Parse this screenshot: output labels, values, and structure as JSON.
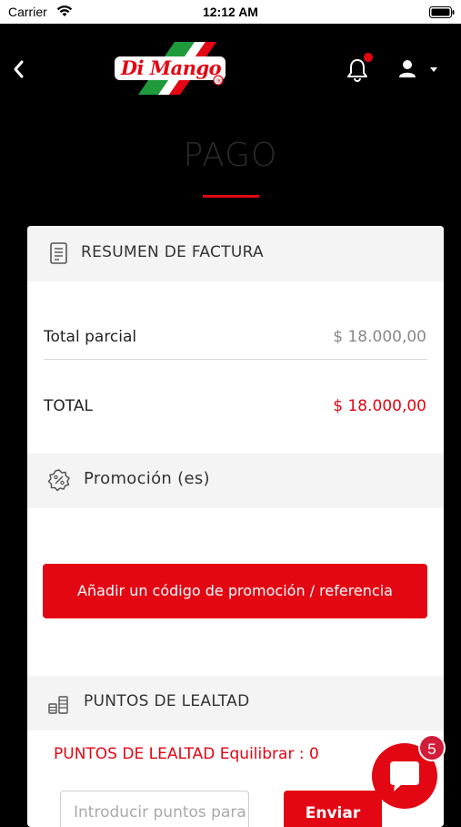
{
  "status_bar": {
    "carrier": "Carrier",
    "time": "12:12 AM"
  },
  "header": {
    "logo_text": "Di Mango"
  },
  "page": {
    "title": "PAGO"
  },
  "invoice": {
    "heading": "RESUMEN DE FACTURA",
    "subtotal_label": "Total parcial",
    "subtotal_value": "$ 18.000,00",
    "total_label": "TOTAL",
    "total_value": "$ 18.000,00"
  },
  "promotion": {
    "heading": "Promoción (es)",
    "button_label": "Añadir un código de promoción / referencia"
  },
  "loyalty": {
    "heading": "PUNTOS DE LEALTAD",
    "balance_text": "PUNTOS DE LEALTAD Equilibrar : 0",
    "input_placeholder": "Introducir puntos para usar",
    "send_label": "Enviar"
  },
  "chat": {
    "badge_count": "5"
  },
  "colors": {
    "accent": "#e30613",
    "background": "#000000",
    "card": "#ffffff",
    "section_header": "#f4f4f4"
  }
}
